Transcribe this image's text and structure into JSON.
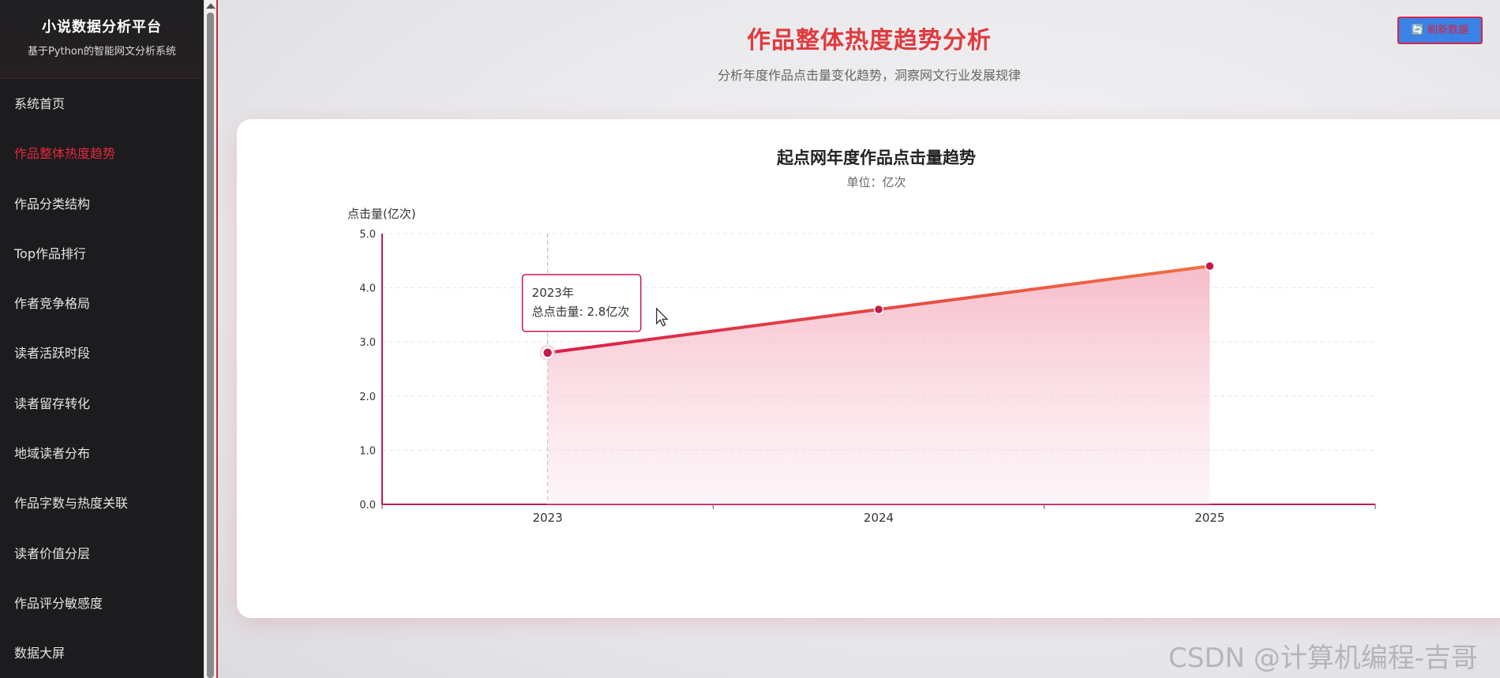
{
  "sidebar": {
    "title": "小说数据分析平台",
    "subtitle": "基于Python的智能网文分析系统",
    "items": [
      {
        "label": "系统首页"
      },
      {
        "label": "作品整体热度趋势"
      },
      {
        "label": "作品分类结构"
      },
      {
        "label": "Top作品排行"
      },
      {
        "label": "作者竞争格局"
      },
      {
        "label": "读者活跃时段"
      },
      {
        "label": "读者留存转化"
      },
      {
        "label": "地域读者分布"
      },
      {
        "label": "作品字数与热度关联"
      },
      {
        "label": "读者价值分层"
      },
      {
        "label": "作品评分敏感度"
      },
      {
        "label": "数据大屏"
      }
    ],
    "active_index": 1
  },
  "header": {
    "title": "作品整体热度趋势分析",
    "subtitle": "分析年度作品点击量变化趋势，洞察网文行业发展规律",
    "refresh_label": "🔄 刷新数据"
  },
  "chart_data": {
    "type": "area",
    "title": "起点网年度作品点击量趋势",
    "subtitle": "单位：亿次",
    "ylabel": "点击量(亿次)",
    "xlabel": "",
    "categories": [
      "2023",
      "2024",
      "2025"
    ],
    "series": [
      {
        "values": [
          2.8,
          3.6,
          4.4
        ]
      }
    ],
    "ylim": [
      0,
      5
    ],
    "yticks": [
      "0.0",
      "1.0",
      "2.0",
      "3.0",
      "4.0",
      "5.0"
    ],
    "grid": true,
    "tooltip": {
      "title": "2023年",
      "text": "总点击量: 2.8亿次",
      "index": 0
    },
    "colors": {
      "line_start": "#d91e49",
      "line_end": "#f2703f",
      "axis": "#c8184a",
      "point": "#c8184a"
    }
  },
  "watermark": "CSDN @计算机编程-吉哥"
}
